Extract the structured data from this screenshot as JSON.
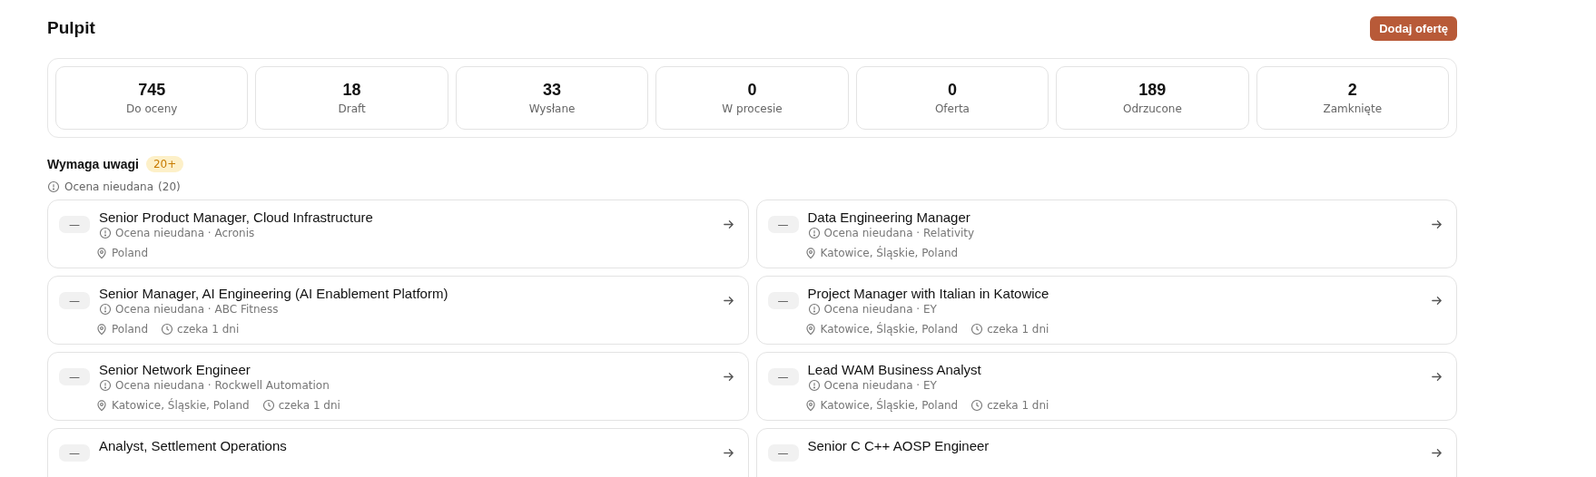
{
  "page": {
    "title": "Pulpit",
    "add_button": "Dodaj ofertę"
  },
  "stats": [
    {
      "value": "745",
      "label": "Do oceny"
    },
    {
      "value": "18",
      "label": "Draft"
    },
    {
      "value": "33",
      "label": "Wysłane"
    },
    {
      "value": "0",
      "label": "W procesie"
    },
    {
      "value": "0",
      "label": "Oferta"
    },
    {
      "value": "189",
      "label": "Odrzucone"
    },
    {
      "value": "2",
      "label": "Zamknięte"
    }
  ],
  "attention": {
    "title": "Wymaga uwagi",
    "badge": "20+",
    "group": {
      "label": "Ocena nieudana",
      "count": "(20)"
    },
    "cards": [
      {
        "score": "—",
        "title": "Senior Product Manager, Cloud Infrastructure",
        "status": "Ocena nieudana · Acronis",
        "location": "Poland"
      },
      {
        "score": "—",
        "title": "Data Engineering Manager",
        "status": "Ocena nieudana · Relativity",
        "location": "Katowice, Śląskie, Poland"
      },
      {
        "score": "—",
        "title": "Senior Manager, AI Engineering (AI Enablement Platform)",
        "status": "Ocena nieudana · ABC Fitness",
        "location": "Poland",
        "waiting": "czeka 1 dni"
      },
      {
        "score": "—",
        "title": "Project Manager with Italian in Katowice",
        "status": "Ocena nieudana · EY",
        "location": "Katowice, Śląskie, Poland",
        "waiting": "czeka 1 dni"
      },
      {
        "score": "—",
        "title": "Senior Network Engineer",
        "status": "Ocena nieudana · Rockwell Automation",
        "location": "Katowice, Śląskie, Poland",
        "waiting": "czeka 1 dni"
      },
      {
        "score": "—",
        "title": "Lead WAM Business Analyst",
        "status": "Ocena nieudana · EY",
        "location": "Katowice, Śląskie, Poland",
        "waiting": "czeka 1 dni"
      },
      {
        "score": "—",
        "title": "Analyst, Settlement Operations"
      },
      {
        "score": "—",
        "title": "Senior C C++ AOSP Engineer"
      }
    ]
  }
}
